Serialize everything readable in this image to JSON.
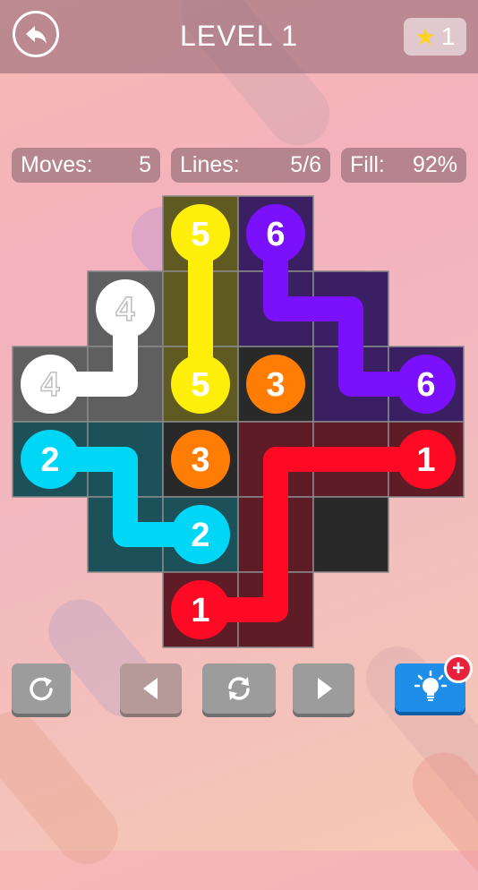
{
  "header": {
    "back_icon": "back-arrow-icon",
    "title": "LEVEL 1",
    "star_icon": "star-icon",
    "stars": "1"
  },
  "stats": {
    "moves_label": "Moves:",
    "moves_value": "5",
    "lines_label": "Lines:",
    "lines_value": "5/6",
    "fill_label": "Fill:",
    "fill_value": "92%"
  },
  "board": {
    "rows": 6,
    "cols": 6,
    "cells": [
      [
        null,
        null,
        "yellow",
        "purple",
        null,
        null
      ],
      [
        null,
        "white",
        "yellow",
        "purple",
        "purple",
        null
      ],
      [
        "white",
        "white",
        "yellow",
        "empty",
        "purple",
        "purple"
      ],
      [
        "cyan",
        "cyan",
        "empty",
        "red",
        "red",
        "red"
      ],
      [
        null,
        "cyan",
        "cyan",
        "red",
        "empty",
        null
      ],
      [
        null,
        null,
        "red",
        "red",
        null,
        null
      ]
    ],
    "colors": {
      "yellow": "#ffef0a",
      "purple": "#7a10fc",
      "white": "#ffffff",
      "cyan": "#00d7f7",
      "orange": "#ff7d04",
      "red": "#ff0a25",
      "empty": "#292929"
    },
    "paths": [
      {
        "color": "yellow",
        "cells": [
          [
            0,
            2
          ],
          [
            1,
            2
          ],
          [
            2,
            2
          ]
        ]
      },
      {
        "color": "purple",
        "cells": [
          [
            0,
            3
          ],
          [
            1,
            3
          ],
          [
            1,
            4
          ],
          [
            2,
            4
          ],
          [
            2,
            5
          ]
        ]
      },
      {
        "color": "white",
        "cells": [
          [
            1,
            1
          ],
          [
            2,
            1
          ],
          [
            2,
            0
          ]
        ]
      },
      {
        "color": "cyan",
        "cells": [
          [
            3,
            0
          ],
          [
            3,
            1
          ],
          [
            4,
            1
          ],
          [
            4,
            2
          ]
        ]
      },
      {
        "color": "red",
        "cells": [
          [
            3,
            5
          ],
          [
            3,
            4
          ],
          [
            3,
            3
          ],
          [
            4,
            3
          ],
          [
            5,
            3
          ],
          [
            5,
            2
          ]
        ]
      }
    ],
    "dots": [
      {
        "cell": [
          0,
          2
        ],
        "color": "yellow",
        "label": "5"
      },
      {
        "cell": [
          2,
          2
        ],
        "color": "yellow",
        "label": "5"
      },
      {
        "cell": [
          0,
          3
        ],
        "color": "purple",
        "label": "6"
      },
      {
        "cell": [
          2,
          5
        ],
        "color": "purple",
        "label": "6"
      },
      {
        "cell": [
          1,
          1
        ],
        "color": "white",
        "label": "4"
      },
      {
        "cell": [
          2,
          0
        ],
        "color": "white",
        "label": "4"
      },
      {
        "cell": [
          2,
          3
        ],
        "color": "orange",
        "label": "3"
      },
      {
        "cell": [
          3,
          2
        ],
        "color": "orange",
        "label": "3"
      },
      {
        "cell": [
          3,
          0
        ],
        "color": "cyan",
        "label": "2"
      },
      {
        "cell": [
          4,
          2
        ],
        "color": "cyan",
        "label": "2"
      },
      {
        "cell": [
          3,
          5
        ],
        "color": "red",
        "label": "1"
      },
      {
        "cell": [
          5,
          2
        ],
        "color": "red",
        "label": "1"
      }
    ]
  },
  "controls": {
    "restart_icon": "restart-icon",
    "prev_icon": "previous-level-icon",
    "shuffle_icon": "refresh-icon",
    "next_icon": "next-level-icon",
    "hint_icon": "lightbulb-icon",
    "hint_badge": "+"
  }
}
